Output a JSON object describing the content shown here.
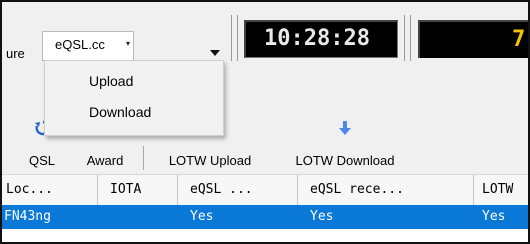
{
  "topbar": {
    "left_label": "ure",
    "service_select": {
      "value": "eQSL.cc",
      "caret": "▾"
    },
    "clock": "10:28:28",
    "freq_partial": "7."
  },
  "menu": {
    "items": [
      {
        "label": "Upload"
      },
      {
        "label": "Download"
      }
    ]
  },
  "toolbar": {
    "items": [
      {
        "label": "QSL",
        "icon": "refresh-icon"
      },
      {
        "label": "Award",
        "icon": "award-icon"
      },
      {
        "label": "LOTW Upload",
        "icon": "upload-icon"
      },
      {
        "label": "LOTW Download",
        "icon": "download-icon"
      }
    ]
  },
  "grid": {
    "columns": [
      "Loc...",
      "IOTA",
      "eQSL ...",
      "eQSL rece...",
      "LOTW"
    ],
    "rows": [
      [
        "FN43ng",
        "",
        "Yes",
        "Yes",
        "Yes"
      ]
    ]
  },
  "colors": {
    "selection": "#0a78d7",
    "clock_text": "#e8e8e8",
    "freq_text": "#f5c400"
  }
}
